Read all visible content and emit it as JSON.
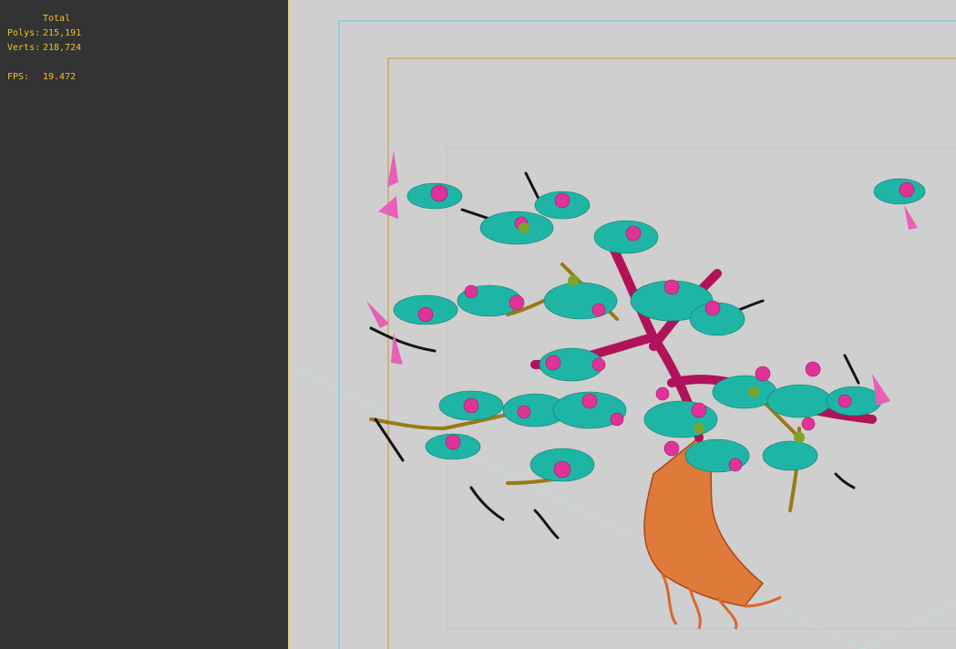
{
  "stats": {
    "header": "Total",
    "polys_label": "Polys:",
    "polys_value": "215,191",
    "verts_label": "Verts:",
    "verts_value": "218,724",
    "fps_label": "FPS:",
    "fps_value": "19.472"
  },
  "colors": {
    "panel_bg": "#333333",
    "stat_text": "#f2c12e",
    "viewport_bg": "#cfcfcf",
    "safe_frame_outer": "#5ad0d6",
    "safe_frame_inner": "#c8962a",
    "trunk": "#d9682a",
    "branches_red": "#b0135a",
    "branches_olive": "#9a7a18",
    "leaves_teal": "#1fb5a5",
    "flowers_pink": "#e0339a",
    "leaves_black": "#141414"
  },
  "viewport": {
    "object": "wireframe bonsai tree"
  }
}
